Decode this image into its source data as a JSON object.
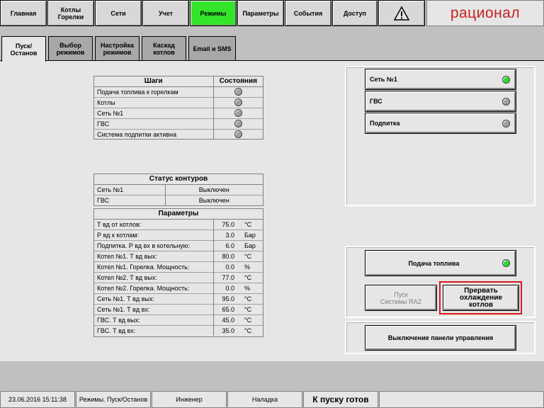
{
  "nav": {
    "home": "Главная",
    "boilers": "Котлы\nГорелки",
    "networks": "Сети",
    "accounting": "Учет",
    "modes": "Режимы",
    "parameters": "Параметры",
    "events": "События",
    "access": "Доступ",
    "alert_icon": "warning-icon",
    "logo": "рационал"
  },
  "tabs": {
    "start_stop": "Пуск/Останов",
    "mode_select": "Выбор\nрежимов",
    "mode_setup": "Настройка\nрежимов",
    "cascade": "Каскад\nкотлов",
    "email_sms": "Email и SMS"
  },
  "steps": {
    "col_steps": "Шаги",
    "col_states": "Состояния",
    "rows": [
      {
        "label": "Подача топлива к горелкам"
      },
      {
        "label": "Котлы"
      },
      {
        "label": "Сеть №1"
      },
      {
        "label": "ГВС"
      },
      {
        "label": "Система подпитки активна"
      }
    ]
  },
  "circuits": {
    "title": "Статус контуров",
    "rows": [
      {
        "name": "Сеть №1",
        "status": "Выключен"
      },
      {
        "name": "ГВС",
        "status": "Выключен"
      }
    ]
  },
  "params": {
    "title": "Параметры",
    "rows": [
      {
        "name": "Т вд от котлов:",
        "value": "75.0",
        "unit": "°C"
      },
      {
        "name": "Р вд к котлам:",
        "value": "3.0",
        "unit": "Бар"
      },
      {
        "name": "Подпитка. Р вд вх в котельную:",
        "value": "6.0",
        "unit": "Бар"
      },
      {
        "name": "Котел №1. Т вд вых:",
        "value": "80.0",
        "unit": "°C"
      },
      {
        "name": "Котел №1. Горелка. Мощность:",
        "value": "0.0",
        "unit": "%"
      },
      {
        "name": "Котел №2. Т вд вых:",
        "value": "77.0",
        "unit": "°C"
      },
      {
        "name": "Котел №2. Горелка. Мощность:",
        "value": "0.0",
        "unit": "%"
      },
      {
        "name": "Сеть №1. Т вд вых:",
        "value": "95.0",
        "unit": "°C"
      },
      {
        "name": "Сеть №1. Т вд вх:",
        "value": "65.0",
        "unit": "°C"
      },
      {
        "name": "ГВС. Т вд вых:",
        "value": "45.0",
        "unit": "°C"
      },
      {
        "name": "ГВС. Т вд вх:",
        "value": "35.0",
        "unit": "°C"
      }
    ]
  },
  "circuit_buttons": {
    "net1": "Сеть №1",
    "hot_water": "ГВС",
    "makeup": "Подпитка"
  },
  "controls": {
    "fuel_supply": "Подача топлива",
    "start_raz": "Пуск\nСистемы RAZ",
    "stop_cooling": "Прервать\nохлаждение\nкотлов",
    "panel_off": "Выключение панели управления"
  },
  "status": {
    "datetime": "23.06.2016 15:11:38",
    "screen": "Режимы. Пуск/Останов",
    "user": "Инженер",
    "mode": "Наладка",
    "state": "К пуску готов"
  },
  "colors": {
    "active_nav": "#33e52a",
    "lamp_on": "#28e028",
    "lamp_off": "#a0a0a0",
    "highlight": "#d81818",
    "logo": "#c8201e"
  }
}
